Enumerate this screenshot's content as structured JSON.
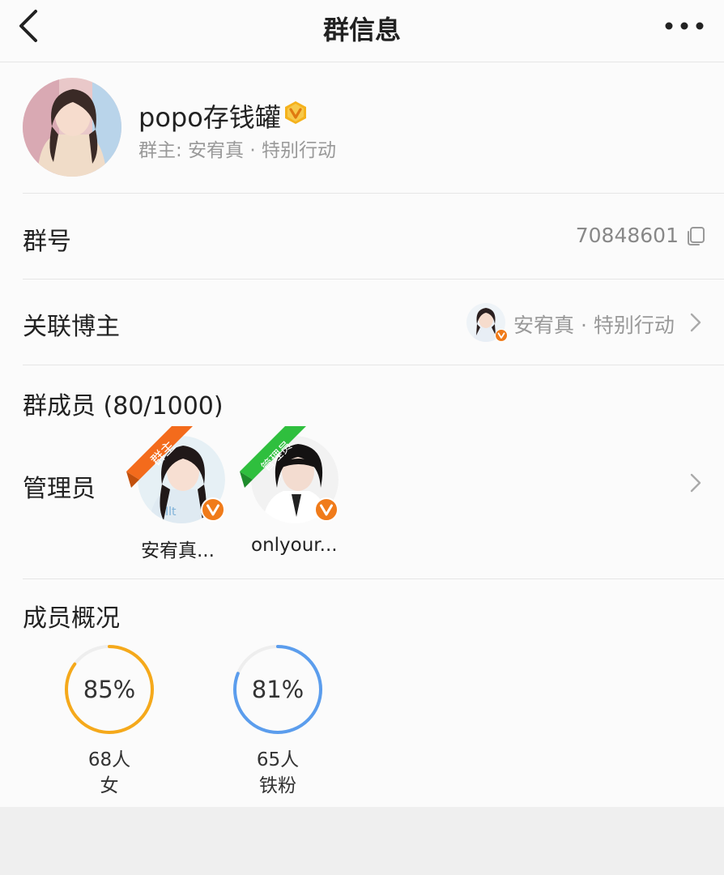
{
  "header": {
    "title": "群信息"
  },
  "group": {
    "name": "popo存钱罐",
    "owner": "群主: 安宥真 · 特别行动"
  },
  "group_id": {
    "label": "群号",
    "value": "70848601"
  },
  "linked_blogger": {
    "label": "关联博主",
    "name": "安宥真 · 特别行动"
  },
  "members": {
    "title": "群成员 (80/1000)",
    "admin_label": "管理员",
    "admins": [
      {
        "name": "安宥真...",
        "role": "群主",
        "ribbon_color": "#f36b1c"
      },
      {
        "name": "onlyour...",
        "role": "管理员",
        "ribbon_color": "#2fbf3e"
      }
    ]
  },
  "overview": {
    "title": "成员概况",
    "stats": [
      {
        "percent": "85%",
        "fraction": 0.85,
        "count": "68人",
        "label": "女",
        "color": "#f5a91b"
      },
      {
        "percent": "81%",
        "fraction": 0.81,
        "count": "65人",
        "label": "铁粉",
        "color": "#5b9ded"
      }
    ]
  },
  "colors": {
    "verified_orange": "#f07b1a",
    "accent_gold": "#f5b21c"
  },
  "icons": [
    "back-chevron-icon",
    "more-dots-icon",
    "verified-v-icon",
    "copy-icon",
    "chevron-right-icon"
  ]
}
